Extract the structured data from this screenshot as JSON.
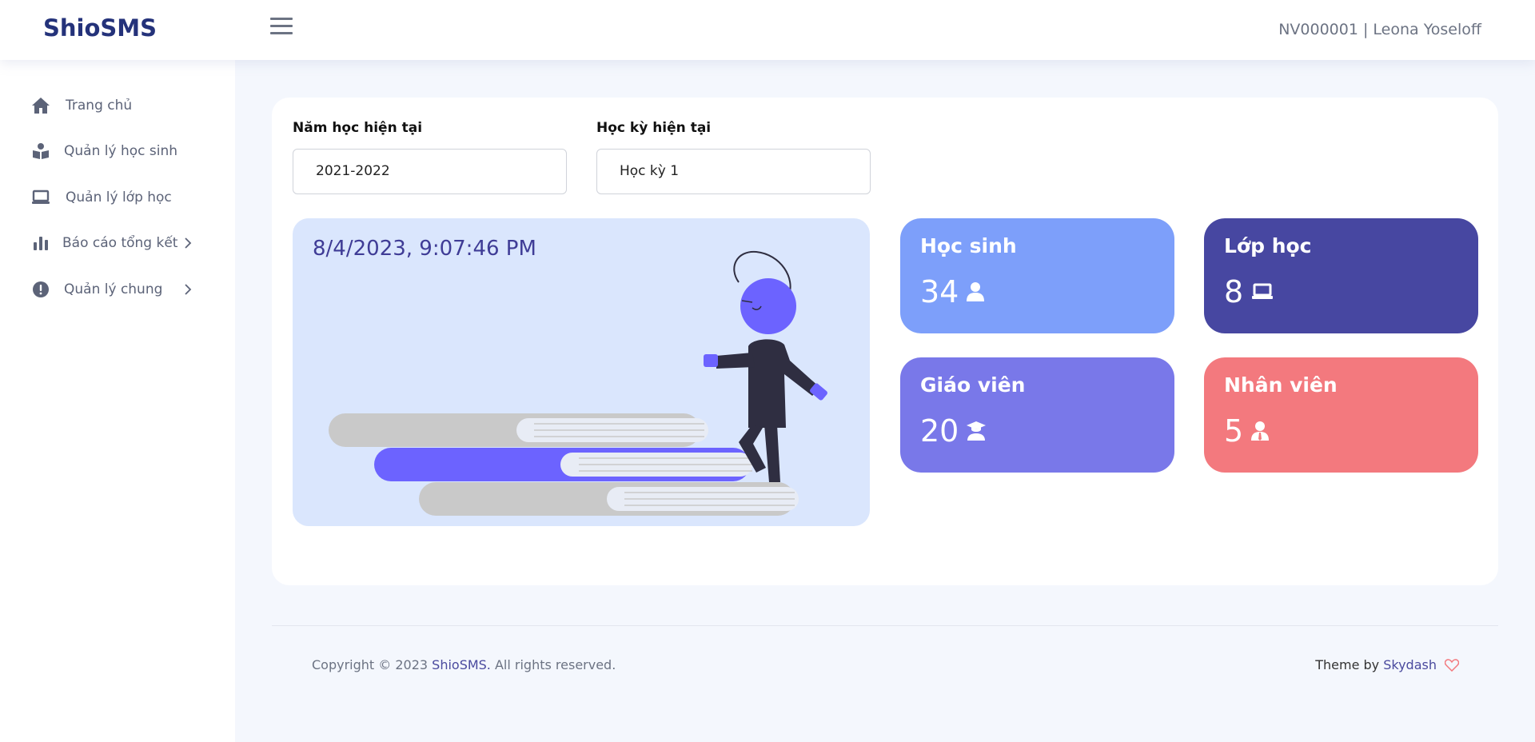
{
  "header": {
    "brand": "ShioSMS",
    "user": "NV000001 | Leona Yoseloff"
  },
  "sidebar": {
    "items": [
      {
        "label": "Trang chủ",
        "icon": "home-icon"
      },
      {
        "label": "Quản lý học sinh",
        "icon": "student-book-icon"
      },
      {
        "label": "Quản lý lớp học",
        "icon": "laptop-icon"
      },
      {
        "label": "Báo cáo tổng kết",
        "icon": "bar-chart-icon",
        "has_submenu": true
      },
      {
        "label": "Quản lý chung",
        "icon": "alert-circle-icon",
        "has_submenu": true
      }
    ]
  },
  "filters": {
    "year_label": "Năm học hiện tại",
    "year_value": "2021-2022",
    "semester_label": "Học kỳ hiện tại",
    "semester_value": "Học kỳ 1"
  },
  "clock": "8/4/2023, 9:07:46 PM",
  "stats": [
    {
      "title": "Học sinh",
      "value": "34",
      "icon": "user-icon",
      "color": "#7d9ffa"
    },
    {
      "title": "Lớp học",
      "value": "8",
      "icon": "laptop-icon",
      "color": "#4747a1"
    },
    {
      "title": "Giáo viên",
      "value": "20",
      "icon": "graduate-icon",
      "color": "#7978e9"
    },
    {
      "title": "Nhân viên",
      "value": "5",
      "icon": "user-tie-icon",
      "color": "#f3797e"
    }
  ],
  "footer": {
    "copyright_prefix": "Copyright © 2023 ",
    "copyright_brand": "ShioSMS.",
    "copyright_suffix": " All rights reserved.",
    "theme_prefix": "Theme by ",
    "theme_link": "Skydash",
    "heart_icon": "heart-icon"
  }
}
